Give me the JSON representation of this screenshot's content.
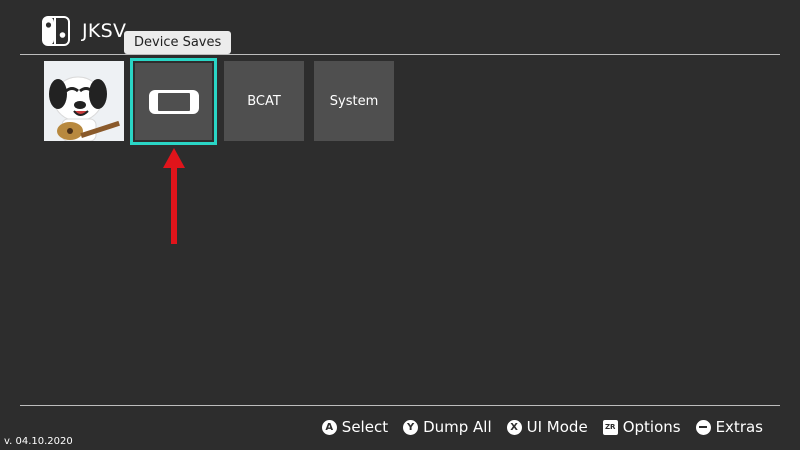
{
  "app": {
    "title": "JKSV",
    "icon": "switch-icon"
  },
  "tooltip": "Device Saves",
  "tiles": [
    {
      "name": "user-avatar",
      "label": ""
    },
    {
      "name": "device-saves",
      "label": "",
      "icon": "handheld-console-icon"
    },
    {
      "name": "bcat",
      "label": "BCAT"
    },
    {
      "name": "system",
      "label": "System"
    }
  ],
  "hints": [
    {
      "button": "A",
      "label": "Select"
    },
    {
      "button": "Y",
      "label": "Dump All"
    },
    {
      "button": "X",
      "label": "UI Mode"
    },
    {
      "button": "ZR",
      "label": "Options"
    },
    {
      "button": "−",
      "label": "Extras"
    }
  ],
  "version": "v. 04.10.2020",
  "colors": {
    "background": "#2d2d2d",
    "tile": "#4f4f4f",
    "selection": "#2ad6c6",
    "arrow": "#e0141b"
  }
}
